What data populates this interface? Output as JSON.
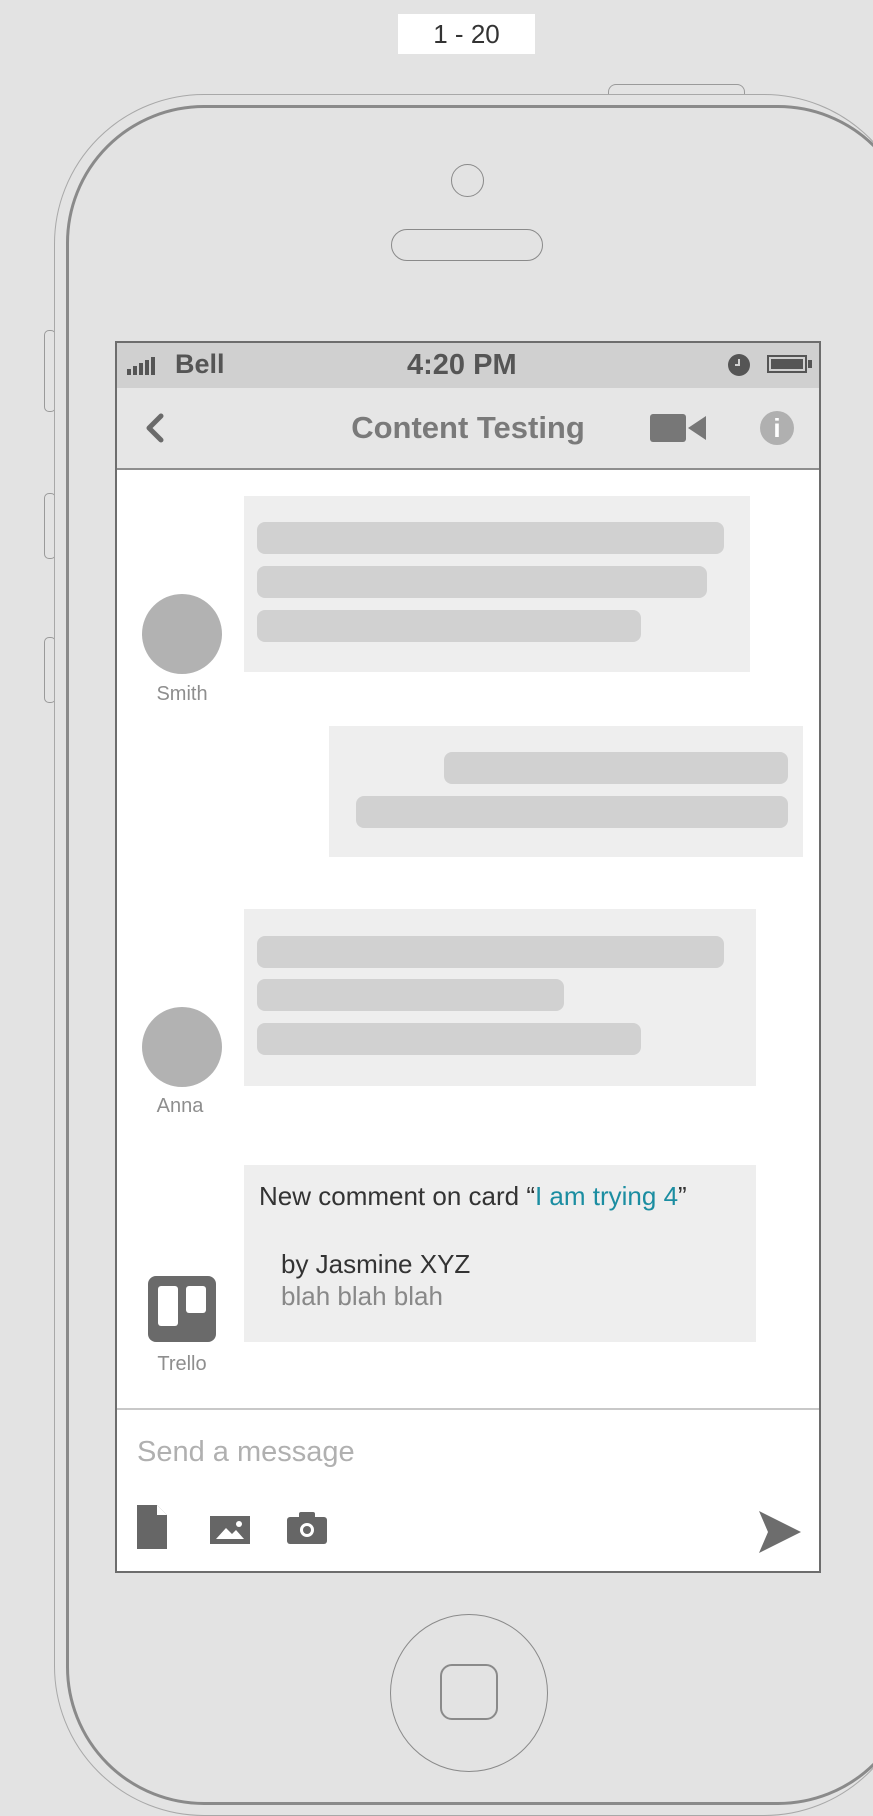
{
  "page_label": "1 - 20",
  "status_bar": {
    "carrier": "Bell",
    "time": "4:20 PM"
  },
  "nav": {
    "title": "Content Testing",
    "back_icon": "chevron-left-icon",
    "video_icon": "video-camera-icon",
    "info_icon": "info-icon",
    "info_glyph": "i"
  },
  "messages": [
    {
      "sender": "Smith",
      "direction": "incoming"
    },
    {
      "sender": "",
      "direction": "outgoing"
    },
    {
      "sender": "Anna",
      "direction": "incoming"
    }
  ],
  "notification": {
    "sender": "Trello",
    "prefix": "New comment on card “",
    "card_name": "I am trying 4",
    "suffix": "”",
    "author_line": "by Jasmine XYZ",
    "comment": "blah blah blah"
  },
  "composer": {
    "placeholder": "Send a message",
    "icons": [
      "file-icon",
      "image-icon",
      "camera-icon",
      "send-icon"
    ]
  },
  "colors": {
    "background": "#e3e3e3",
    "bubble": "#eeeeee",
    "placeholder_bar": "#d1d1d1",
    "link": "#1b8da1"
  }
}
